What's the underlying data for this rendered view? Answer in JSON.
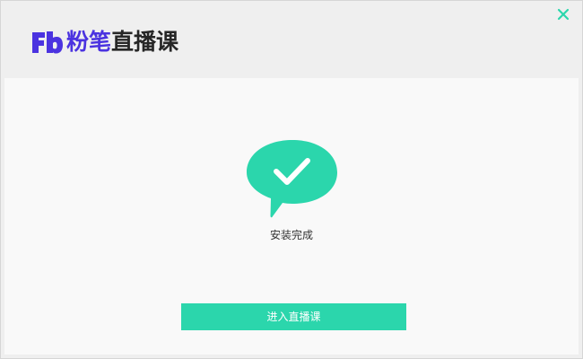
{
  "header": {
    "logo": {
      "mark_text": "Fb",
      "brand_text": "粉笔",
      "product_text": "直播课",
      "brand_color": "#4b33e0",
      "product_color": "#262626"
    },
    "close_icon": "close-icon",
    "close_color": "#2bd6ac"
  },
  "main": {
    "status_icon": "chat-bubble-check-icon",
    "status_icon_color": "#2bd6ac",
    "status_text": "安装完成",
    "enter_button_label": "进入直播课",
    "accent_color": "#2bd6ac"
  }
}
